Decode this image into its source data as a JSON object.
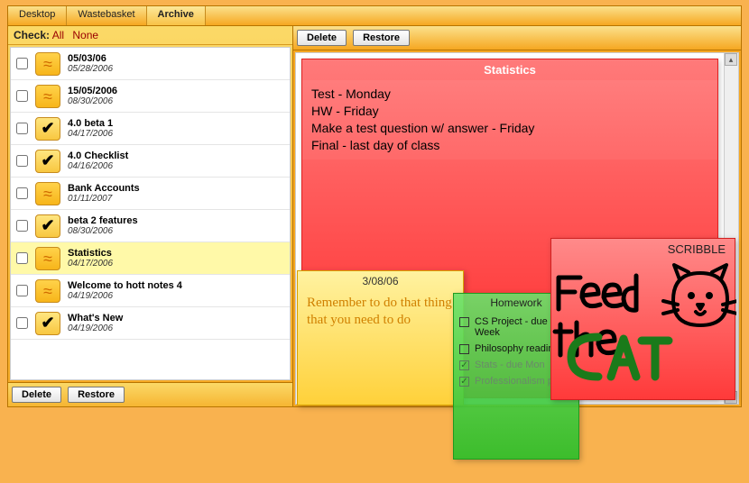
{
  "tabs": [
    {
      "label": "Desktop"
    },
    {
      "label": "Wastebasket"
    },
    {
      "label": "Archive"
    }
  ],
  "activeTab": "Archive",
  "checkbar": {
    "label": "Check:",
    "all": "All",
    "none": "None"
  },
  "buttons": {
    "delete": "Delete",
    "restore": "Restore"
  },
  "list": [
    {
      "title": "05/03/06",
      "date": "05/28/2006",
      "icon": "note",
      "selected": false
    },
    {
      "title": "15/05/2006",
      "date": "08/30/2006",
      "icon": "note",
      "selected": false
    },
    {
      "title": "4.0 beta 1",
      "date": "04/17/2006",
      "icon": "check",
      "selected": false
    },
    {
      "title": "4.0 Checklist",
      "date": "04/16/2006",
      "icon": "check",
      "selected": false
    },
    {
      "title": "Bank Accounts",
      "date": "01/11/2007",
      "icon": "note",
      "selected": false
    },
    {
      "title": "beta 2 features",
      "date": "08/30/2006",
      "icon": "check",
      "selected": false
    },
    {
      "title": "Statistics",
      "date": "04/17/2006",
      "icon": "note",
      "selected": true
    },
    {
      "title": "Welcome to hott notes 4",
      "date": "04/19/2006",
      "icon": "note",
      "selected": false
    },
    {
      "title": "What's New",
      "date": "04/19/2006",
      "icon": "check",
      "selected": false
    }
  ],
  "previewNote": {
    "title": "Statistics",
    "body": "Test - Monday\nHW - Friday\nMake a test question w/ answer - Friday\nFinal - last day of class"
  },
  "yellowNote": {
    "date": "3/08/06",
    "body": "Remember to do that thing that you need to do"
  },
  "greenNote": {
    "title": "Homework",
    "items": [
      {
        "text": "CS Project - due Next Week",
        "done": false
      },
      {
        "text": "Philosophy reading",
        "done": false
      },
      {
        "text": "Stats - due Mon",
        "done": true
      },
      {
        "text": "Professionalism paper",
        "done": true
      }
    ]
  },
  "scribbleNote": {
    "title": "SCRIBBLE",
    "drawingCaption": "Feed the CAT"
  }
}
